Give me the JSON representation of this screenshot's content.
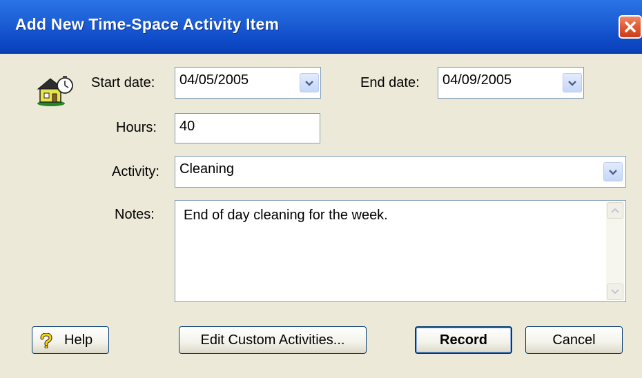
{
  "window": {
    "title": "Add New Time-Space Activity Item"
  },
  "form": {
    "start_date_label": "Start date:",
    "start_date_value": "04/05/2005",
    "end_date_label": "End date:",
    "end_date_value": "04/09/2005",
    "hours_label": "Hours:",
    "hours_value": "40",
    "activity_label": "Activity:",
    "activity_value": "Cleaning",
    "notes_label": "Notes:",
    "notes_value": "End of day cleaning for the week."
  },
  "buttons": {
    "help": "Help",
    "edit_custom": "Edit Custom Activities...",
    "record": "Record",
    "cancel": "Cancel"
  },
  "icons": {
    "app": "house-clock-icon",
    "close": "close-icon",
    "dropdown": "chevron-down-icon",
    "help": "question-mark-icon",
    "scroll_up": "scroll-up-arrow-icon",
    "scroll_down": "scroll-down-arrow-icon"
  },
  "colors": {
    "titlebar": "#0a3fb5",
    "close": "#df5a33",
    "dialog_bg": "#ece9d8",
    "field_border": "#7f9db9"
  }
}
